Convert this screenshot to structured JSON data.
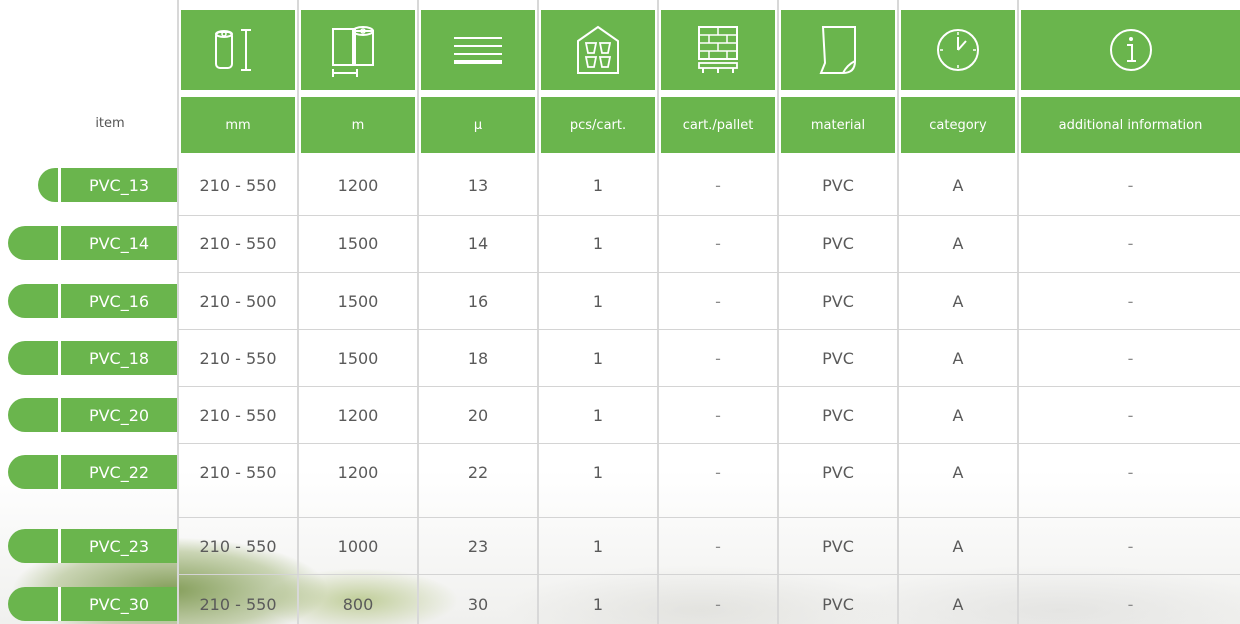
{
  "header": {
    "item_label": "item",
    "columns": [
      {
        "icon": "roll-width-icon",
        "unit": "mm"
      },
      {
        "icon": "roll-length-icon",
        "unit": "m"
      },
      {
        "icon": "thickness-lines-icon",
        "unit": "μ"
      },
      {
        "icon": "carton-cups-icon",
        "unit": "pcs/cart."
      },
      {
        "icon": "pallet-bricks-icon",
        "unit": "cart./pallet"
      },
      {
        "icon": "sheet-material-icon",
        "unit": "material"
      },
      {
        "icon": "clock-icon",
        "unit": "category"
      },
      {
        "icon": "info-icon",
        "unit": "additional information"
      }
    ]
  },
  "rows": [
    {
      "item": "PVC_13",
      "mm": "210 - 550",
      "m": "1200",
      "mu": "13",
      "pcs": "1",
      "pallet": "-",
      "material": "PVC",
      "category": "A",
      "info": "-"
    },
    {
      "item": "PVC_14",
      "mm": "210 - 550",
      "m": "1500",
      "mu": "14",
      "pcs": "1",
      "pallet": "-",
      "material": "PVC",
      "category": "A",
      "info": "-"
    },
    {
      "item": "PVC_16",
      "mm": "210 - 500",
      "m": "1500",
      "mu": "16",
      "pcs": "1",
      "pallet": "-",
      "material": "PVC",
      "category": "A",
      "info": "-"
    },
    {
      "item": "PVC_18",
      "mm": "210 - 550",
      "m": "1500",
      "mu": "18",
      "pcs": "1",
      "pallet": "-",
      "material": "PVC",
      "category": "A",
      "info": "-"
    },
    {
      "item": "PVC_20",
      "mm": "210 - 550",
      "m": "1200",
      "mu": "20",
      "pcs": "1",
      "pallet": "-",
      "material": "PVC",
      "category": "A",
      "info": "-"
    },
    {
      "item": "PVC_22",
      "mm": "210 - 550",
      "m": "1200",
      "mu": "22",
      "pcs": "1",
      "pallet": "-",
      "material": "PVC",
      "category": "A",
      "info": "-"
    },
    {
      "item": "PVC_23",
      "mm": "210 - 550",
      "m": "1000",
      "mu": "23",
      "pcs": "1",
      "pallet": "-",
      "material": "PVC",
      "category": "A",
      "info": "-"
    },
    {
      "item": "PVC_30",
      "mm": "210 - 550",
      "m": "800",
      "mu": "30",
      "pcs": "1",
      "pallet": "-",
      "material": "PVC",
      "category": "A",
      "info": "-"
    }
  ],
  "colors": {
    "accent": "#6ab54d",
    "text": "#5a5a5a",
    "grid": "#d8d8d8"
  }
}
